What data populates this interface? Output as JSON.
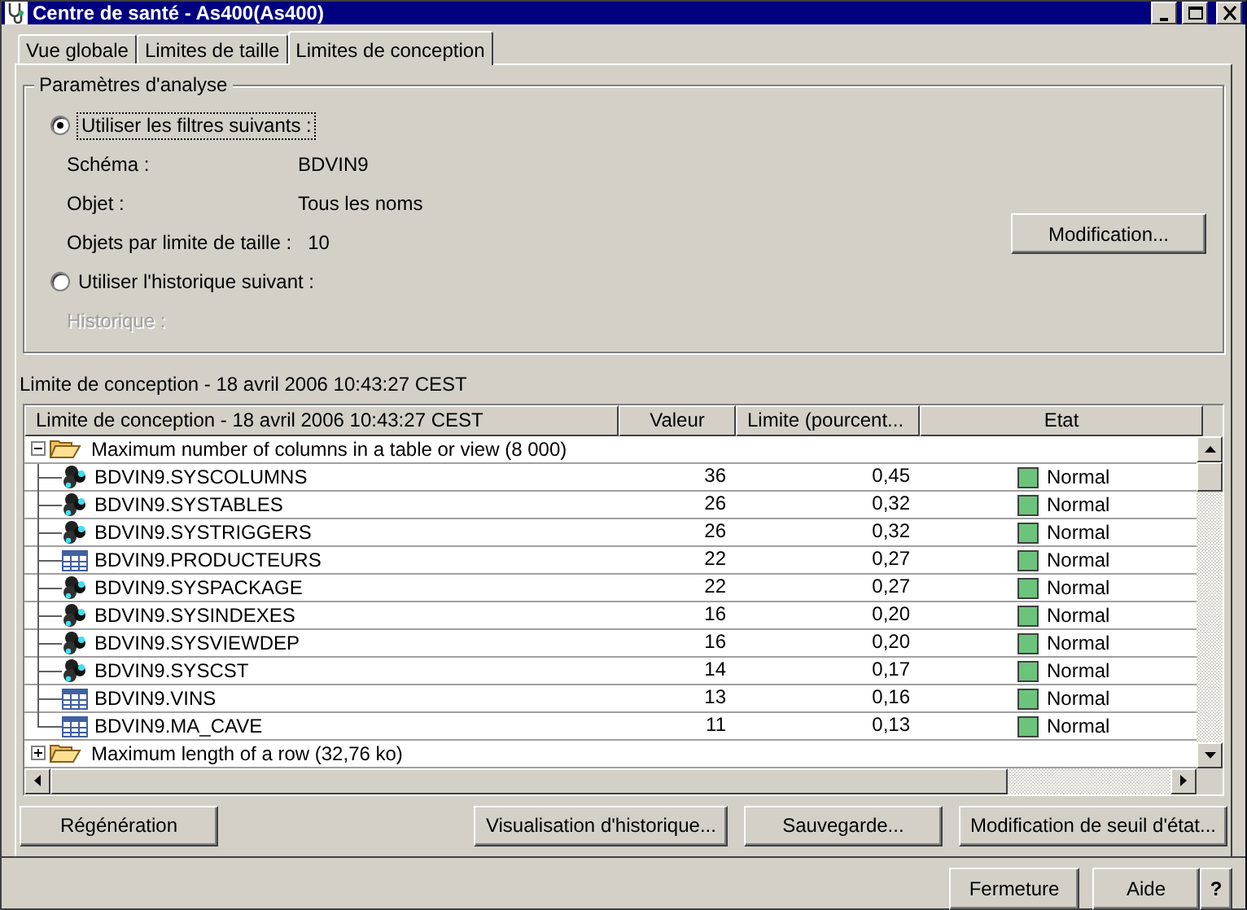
{
  "window": {
    "title": "Centre de santé - As400(As400)"
  },
  "tabs": [
    {
      "label": "Vue globale",
      "selected": false
    },
    {
      "label": "Limites de taille",
      "selected": false
    },
    {
      "label": "Limites de conception",
      "selected": true
    }
  ],
  "analysis": {
    "legend": "Paramètres d'analyse",
    "modify_button": "Modification...",
    "items": [
      {
        "kind": "radio",
        "label": "Utiliser les filtres suivants :",
        "selected": true
      },
      {
        "kind": "field",
        "label": "Schéma :",
        "value": "BDVIN9",
        "disabled": false
      },
      {
        "kind": "field",
        "label": "Objet :",
        "value": "Tous les noms",
        "disabled": false
      },
      {
        "kind": "field",
        "label": "Objets par limite de taille :",
        "value": "10",
        "disabled": false
      },
      {
        "kind": "radio",
        "label": "Utiliser l'historique suivant :",
        "selected": false
      },
      {
        "kind": "field",
        "label": "Historique :",
        "disabled": true
      }
    ]
  },
  "report": {
    "caption": "Limite de conception - 18 avril 2006 10:43:27 CEST",
    "columns": [
      "Limite de conception - 18 avril 2006 10:43:27 CEST",
      "Valeur",
      "Limite (pourcent...",
      "Etat"
    ],
    "groups": [
      {
        "label": "Maximum number of columns in a table or view  (8 000)",
        "expanded": true,
        "children": [
          {
            "kind": "system",
            "name": "BDVIN9.SYSCOLUMNS",
            "value": "36",
            "limit": "0,45",
            "state": "Normal",
            "color": "#6cc47c"
          },
          {
            "kind": "system",
            "name": "BDVIN9.SYSTABLES",
            "value": "26",
            "limit": "0,32",
            "state": "Normal",
            "color": "#6cc47c"
          },
          {
            "kind": "system",
            "name": "BDVIN9.SYSTRIGGERS",
            "value": "26",
            "limit": "0,32",
            "state": "Normal",
            "color": "#6cc47c"
          },
          {
            "kind": "table",
            "name": "BDVIN9.PRODUCTEURS",
            "value": "22",
            "limit": "0,27",
            "state": "Normal",
            "color": "#6cc47c"
          },
          {
            "kind": "system",
            "name": "BDVIN9.SYSPACKAGE",
            "value": "22",
            "limit": "0,27",
            "state": "Normal",
            "color": "#6cc47c"
          },
          {
            "kind": "system",
            "name": "BDVIN9.SYSINDEXES",
            "value": "16",
            "limit": "0,20",
            "state": "Normal",
            "color": "#6cc47c"
          },
          {
            "kind": "system",
            "name": "BDVIN9.SYSVIEWDEP",
            "value": "16",
            "limit": "0,20",
            "state": "Normal",
            "color": "#6cc47c"
          },
          {
            "kind": "system",
            "name": "BDVIN9.SYSCST",
            "value": "14",
            "limit": "0,17",
            "state": "Normal",
            "color": "#6cc47c"
          },
          {
            "kind": "table",
            "name": "BDVIN9.VINS",
            "value": "13",
            "limit": "0,16",
            "state": "Normal",
            "color": "#6cc47c"
          },
          {
            "kind": "table",
            "name": "BDVIN9.MA_CAVE",
            "value": "11",
            "limit": "0,13",
            "state": "Normal",
            "color": "#6cc47c"
          }
        ]
      },
      {
        "label": "Maximum length of a row  (32,76 ko)",
        "expanded": false
      }
    ]
  },
  "actions": [
    "Régénération",
    "Visualisation d'historique...",
    "Sauvegarde...",
    "Modification de seuil d'état..."
  ],
  "footer": [
    "Fermeture",
    "Aide",
    "?"
  ]
}
